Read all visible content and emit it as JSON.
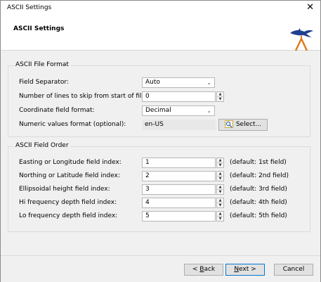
{
  "window": {
    "title": "ASCII Settings",
    "close_glyph": "✕"
  },
  "header": {
    "title": "ASCII Settings",
    "logo_icon": "swordfish-logo-icon"
  },
  "file_format": {
    "group_label": "ASCII File Format",
    "field_separator": {
      "label": "Field Separator:",
      "value": "Auto"
    },
    "skip_lines": {
      "label": "Number of lines to skip from start of file:",
      "value": "0"
    },
    "coord_format": {
      "label": "Coordinate field format:",
      "value": "Decimal"
    },
    "numeric_format": {
      "label": "Numeric values format (optional):",
      "value": "en-US",
      "button": "Select..."
    }
  },
  "field_order": {
    "group_label": "ASCII Field Order",
    "rows": [
      {
        "label": "Easting or Longitude field index:",
        "value": "1",
        "default": "(default: 1st field)"
      },
      {
        "label": "Northing or Latitude field index:",
        "value": "2",
        "default": "(default: 2nd field)"
      },
      {
        "label": "Ellipsoidal height field index:",
        "value": "3",
        "default": "(default: 3rd field)"
      },
      {
        "label": "Hi frequency depth field index:",
        "value": "4",
        "default": "(default: 4th field)"
      },
      {
        "label": "Lo frequency depth field index:",
        "value": "5",
        "default": "(default: 5th field)"
      }
    ]
  },
  "buttons": {
    "back_prefix": "< ",
    "back_key": "B",
    "back_rest": "ack",
    "next_key": "N",
    "next_rest": "ext >",
    "cancel": "Cancel"
  },
  "colors": {
    "accent": "#0078d4",
    "logo_blue": "#1f3f8f",
    "logo_orange": "#e07a1f"
  }
}
